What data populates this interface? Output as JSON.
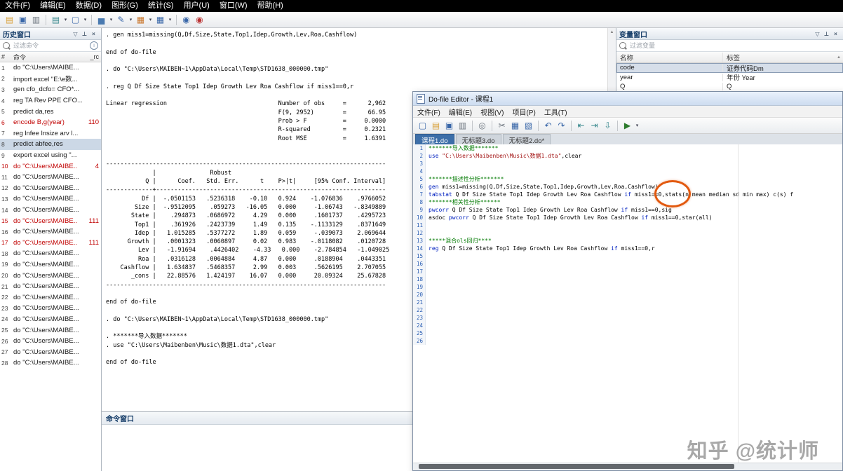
{
  "menu_bar": {
    "items": [
      "文件(F)",
      "编辑(E)",
      "数据(D)",
      "图形(G)",
      "统计(S)",
      "用户(U)",
      "窗口(W)",
      "帮助(H)"
    ]
  },
  "main_toolbar": {
    "icons": [
      {
        "name": "open-icon",
        "glyph": "▤",
        "cls": "yellow"
      },
      {
        "name": "save-icon",
        "glyph": "▣",
        "cls": "blue"
      },
      {
        "name": "print-icon",
        "glyph": "▥",
        "cls": "gray"
      },
      {
        "name": "toolbar-separator",
        "glyph": "",
        "cls": "sep"
      },
      {
        "name": "log-icon",
        "glyph": "▤",
        "cls": "teal"
      },
      {
        "name": "log-dropdown-icon",
        "glyph": "▾",
        "cls": "drop"
      },
      {
        "name": "viewer-icon",
        "glyph": "▢",
        "cls": "blue"
      },
      {
        "name": "viewer-dropdown-icon",
        "glyph": "▾",
        "cls": "drop"
      },
      {
        "name": "toolbar-separator",
        "glyph": "",
        "cls": "sep"
      },
      {
        "name": "graph-icon",
        "glyph": "▅",
        "cls": "graph"
      },
      {
        "name": "graph-dropdown-icon",
        "glyph": "▾",
        "cls": "drop"
      },
      {
        "name": "dofile-editor-icon",
        "glyph": "✎",
        "cls": "blue"
      },
      {
        "name": "dofile-editor-dropdown-icon",
        "glyph": "▾",
        "cls": "drop"
      },
      {
        "name": "data-editor-icon",
        "glyph": "▦",
        "cls": "orange"
      },
      {
        "name": "data-editor-dropdown-icon",
        "glyph": "▾",
        "cls": "drop"
      },
      {
        "name": "data-browser-icon",
        "glyph": "▦",
        "cls": "blue"
      },
      {
        "name": "data-browser-dropdown-icon",
        "glyph": "▾",
        "cls": "drop"
      },
      {
        "name": "toolbar-separator",
        "glyph": "",
        "cls": "sep"
      },
      {
        "name": "more-icon",
        "glyph": "◉",
        "cls": "blue"
      },
      {
        "name": "break-icon",
        "glyph": "◉",
        "cls": "red"
      }
    ]
  },
  "panel_icons": {
    "filter": "▽",
    "pin": "⊥",
    "close": "×",
    "scroll_up": "▲"
  },
  "history_panel": {
    "title": "历史窗口",
    "filter_placeholder": "过滤命令",
    "columns": {
      "num": "#",
      "command": "命令",
      "rc": "_rc"
    },
    "rows": [
      {
        "n": 1,
        "text": "do \"C:\\Users\\MAIBE...",
        "rc": "",
        "state": "normal"
      },
      {
        "n": 2,
        "text": "import excel \"E:\\e数...",
        "rc": "",
        "state": "normal"
      },
      {
        "n": 3,
        "text": "gen cfo_dcfo= CFO*...",
        "rc": "",
        "state": "normal"
      },
      {
        "n": 4,
        "text": "reg TA Rev PPE CFO...",
        "rc": "",
        "state": "normal"
      },
      {
        "n": 5,
        "text": "predict da,res",
        "rc": "",
        "state": "normal"
      },
      {
        "n": 6,
        "text": "encode B,g(year)",
        "rc": "110",
        "state": "error"
      },
      {
        "n": 7,
        "text": "reg lnfee lnsize arv l...",
        "rc": "",
        "state": "normal"
      },
      {
        "n": 8,
        "text": "predict abfee,res",
        "rc": "",
        "state": "selected"
      },
      {
        "n": 9,
        "text": "export excel using \"...",
        "rc": "",
        "state": "normal"
      },
      {
        "n": 10,
        "text": "do \"C:\\Users\\MAIBE..",
        "rc": "4",
        "state": "error"
      },
      {
        "n": 11,
        "text": "do \"C:\\Users\\MAIBE...",
        "rc": "",
        "state": "normal"
      },
      {
        "n": 12,
        "text": "do \"C:\\Users\\MAIBE...",
        "rc": "",
        "state": "normal"
      },
      {
        "n": 13,
        "text": "do \"C:\\Users\\MAIBE...",
        "rc": "",
        "state": "normal"
      },
      {
        "n": 14,
        "text": "do \"C:\\Users\\MAIBE...",
        "rc": "",
        "state": "normal"
      },
      {
        "n": 15,
        "text": "do \"C:\\Users\\MAIBE..",
        "rc": "111",
        "state": "error"
      },
      {
        "n": 16,
        "text": "do \"C:\\Users\\MAIBE...",
        "rc": "",
        "state": "normal"
      },
      {
        "n": 17,
        "text": "do \"C:\\Users\\MAIBE..",
        "rc": "111",
        "state": "error"
      },
      {
        "n": 18,
        "text": "do \"C:\\Users\\MAIBE...",
        "rc": "",
        "state": "normal"
      },
      {
        "n": 19,
        "text": "do \"C:\\Users\\MAIBE...",
        "rc": "",
        "state": "normal"
      },
      {
        "n": 20,
        "text": "do \"C:\\Users\\MAIBE...",
        "rc": "",
        "state": "normal"
      },
      {
        "n": 21,
        "text": "do \"C:\\Users\\MAIBE...",
        "rc": "",
        "state": "normal"
      },
      {
        "n": 22,
        "text": "do \"C:\\Users\\MAIBE...",
        "rc": "",
        "state": "normal"
      },
      {
        "n": 23,
        "text": "do \"C:\\Users\\MAIBE...",
        "rc": "",
        "state": "normal"
      },
      {
        "n": 24,
        "text": "do \"C:\\Users\\MAIBE...",
        "rc": "",
        "state": "normal"
      },
      {
        "n": 25,
        "text": "do \"C:\\Users\\MAIBE...",
        "rc": "",
        "state": "normal"
      },
      {
        "n": 26,
        "text": "do \"C:\\Users\\MAIBE...",
        "rc": "",
        "state": "normal"
      },
      {
        "n": 27,
        "text": "do \"C:\\Users\\MAIBE...",
        "rc": "",
        "state": "normal"
      },
      {
        "n": 28,
        "text": "do \"C:\\Users\\MAIBE...",
        "rc": "",
        "state": "normal"
      }
    ]
  },
  "results_window": {
    "lines": [
      ". gen miss1=missing(Q,Df,Size,State,Top1,Idep,Growth,Lev,Roa,Cashflow)",
      "",
      "end of do-file",
      "",
      ". do \"C:\\Users\\MAIBEN~1\\AppData\\Local\\Temp\\STD1638_000000.tmp\"",
      "",
      ". reg Q Df Size State Top1 Idep Growth Lev Roa Cashflow if miss1==0,r",
      "",
      "Linear regression                               Number of obs     =      2,962",
      "                                                F(9, 2952)        =      66.95",
      "                                                Prob > F          =     0.0000",
      "                                                R-squared         =     0.2321",
      "                                                Root MSE          =     1.6391",
      "",
      "",
      "------------------------------------------------------------------------------",
      "             |               Robust",
      "           Q |      Coef.   Std. Err.      t    P>|t|     [95% Conf. Interval]",
      "-------------+----------------------------------------------------------------",
      "          Df |  -.0501153   .5236318    -0.10   0.924    -1.076836    .9766052",
      "        Size |  -.9512095    .059273   -16.05   0.000     -1.06743   -.8349889",
      "       State |    .294873   .0686972     4.29   0.000     .1601737    .4295723",
      "        Top1 |    .361926   .2423739     1.49   0.135    -.1133129    .8371649",
      "        Idep |   1.015285   .5377272     1.89   0.059     -.039073    2.069644",
      "      Growth |   .0001323   .0060897     0.02   0.983    -.0118082    .0120728",
      "         Lev |   -1.91694    .4426402    -4.33   0.000    -2.784854   -1.049025",
      "         Roa |   .0316128   .0064884     4.87   0.000     .0188904    .0443351",
      "    Cashflow |   1.634837   .5468357     2.99   0.003     .5626195    2.707055",
      "       _cons |   22.88576   1.424197    16.07   0.000     20.09324    25.67828",
      "------------------------------------------------------------------------------",
      "",
      "end of do-file",
      "",
      ". do \"C:\\Users\\MAIBEN~1\\AppData\\Local\\Temp\\STD1638_000000.tmp\"",
      "",
      ". *******导入数据*******",
      ". use \"C:\\Users\\Maibenben\\Music\\数据1.dta\",clear",
      "",
      "end of do-file",
      ""
    ]
  },
  "command_window": {
    "title": "命令窗口"
  },
  "variables_panel": {
    "title": "变量窗口",
    "filter_placeholder": "过滤变量",
    "columns": {
      "name": "名称",
      "label": "标签"
    },
    "rows": [
      {
        "name": "code",
        "label": "证券代码Dm",
        "state": "selected"
      },
      {
        "name": "year",
        "label": "年份 Year",
        "state": "normal"
      },
      {
        "name": "Q",
        "label": "Q",
        "state": "normal"
      }
    ]
  },
  "dofile_editor": {
    "title": "Do-file Editor - 课程1",
    "menu_items": [
      "文件(F)",
      "编辑(E)",
      "视图(V)",
      "项目(P)",
      "工具(T)"
    ],
    "toolbar": {
      "icons": [
        {
          "name": "new-file-icon",
          "glyph": "▢",
          "cls": "blue"
        },
        {
          "name": "open-icon",
          "glyph": "▤",
          "cls": "yellow"
        },
        {
          "name": "save-icon",
          "glyph": "▣",
          "cls": "blue"
        },
        {
          "name": "print-icon",
          "glyph": "▥",
          "cls": "gray"
        },
        {
          "name": "toolbar-separator",
          "glyph": "",
          "cls": "sep"
        },
        {
          "name": "find-icon",
          "glyph": "◎",
          "cls": "gray"
        },
        {
          "name": "toolbar-separator",
          "glyph": "",
          "cls": "sep"
        },
        {
          "name": "cut-icon",
          "glyph": "✂",
          "cls": "gray"
        },
        {
          "name": "copy-icon",
          "glyph": "▦",
          "cls": "blue"
        },
        {
          "name": "paste-icon",
          "glyph": "▧",
          "cls": "blue"
        },
        {
          "name": "toolbar-separator",
          "glyph": "",
          "cls": "sep"
        },
        {
          "name": "undo-icon",
          "glyph": "↶",
          "cls": "blue"
        },
        {
          "name": "redo-icon",
          "glyph": "↷",
          "cls": "blue"
        },
        {
          "name": "toolbar-separator",
          "glyph": "",
          "cls": "sep"
        },
        {
          "name": "indent-decrease-icon",
          "glyph": "⇤",
          "cls": "teal"
        },
        {
          "name": "indent-increase-icon",
          "glyph": "⇥",
          "cls": "teal"
        },
        {
          "name": "bookmark-down-icon",
          "glyph": "⇩",
          "cls": "teal"
        },
        {
          "name": "toolbar-separator",
          "glyph": "",
          "cls": "sep"
        },
        {
          "name": "execute-do-icon",
          "glyph": "▶",
          "cls": "run"
        },
        {
          "name": "execute-dropdown-icon",
          "glyph": "▾",
          "cls": "drop"
        }
      ]
    },
    "tabs": [
      {
        "label": "课程1.do",
        "state": "active"
      },
      {
        "label": "无标题3.do",
        "state": "normal"
      },
      {
        "label": "无标题2.do*",
        "state": "normal"
      }
    ],
    "lines": [
      {
        "n": 1,
        "segs": [
          {
            "t": "*******导入数据*******",
            "c": "cmt"
          }
        ]
      },
      {
        "n": 2,
        "segs": [
          {
            "t": "use ",
            "c": "kw"
          },
          {
            "t": "\"C:\\Users\\Maibenben\\Music\\数据1.dta\"",
            "c": "str"
          },
          {
            "t": ",clear",
            "c": "txt"
          }
        ]
      },
      {
        "n": 3,
        "segs": []
      },
      {
        "n": 4,
        "segs": []
      },
      {
        "n": 5,
        "segs": [
          {
            "t": "*******描述性分析*******",
            "c": "cmt"
          }
        ]
      },
      {
        "n": 6,
        "segs": [
          {
            "t": "gen ",
            "c": "kw"
          },
          {
            "t": "miss1=missing(Q,Df,Size,State,Top1,Idep,Growth,Lev,Roa,Cashflow)",
            "c": "txt"
          }
        ]
      },
      {
        "n": 7,
        "segs": [
          {
            "t": "tabstat ",
            "c": "kw"
          },
          {
            "t": "Q Df Size State Top1 Idep Growth Lev Roa Cashflow ",
            "c": "txt"
          },
          {
            "t": "if",
            "c": "kw"
          },
          {
            "t": " miss1==0,stats(n mean median sd min max) c(s) f",
            "c": "txt"
          }
        ]
      },
      {
        "n": 8,
        "segs": [
          {
            "t": "*******相关性分析******",
            "c": "cmt"
          }
        ]
      },
      {
        "n": 9,
        "segs": [
          {
            "t": "pwcorr ",
            "c": "kw"
          },
          {
            "t": "Q Df Size State Top1 Idep Growth Lev Roa Cashflow ",
            "c": "txt"
          },
          {
            "t": "if",
            "c": "kw"
          },
          {
            "t": " miss1==0,sig",
            "c": "txt"
          }
        ]
      },
      {
        "n": 10,
        "segs": [
          {
            "t": "asdoc ",
            "c": "txt"
          },
          {
            "t": "pwcorr ",
            "c": "kw"
          },
          {
            "t": "Q Df Size State Top1 Idep Growth Lev Roa Cashflow ",
            "c": "txt"
          },
          {
            "t": "if",
            "c": "kw"
          },
          {
            "t": " miss1==0,star(all)",
            "c": "txt"
          }
        ]
      },
      {
        "n": 11,
        "segs": []
      },
      {
        "n": 12,
        "segs": []
      },
      {
        "n": 13,
        "segs": [
          {
            "t": "*****混合ols回归****",
            "c": "cmt"
          }
        ]
      },
      {
        "n": 14,
        "segs": [
          {
            "t": "reg ",
            "c": "kw"
          },
          {
            "t": "Q Df Size State Top1 Idep Growth Lev Roa Cashflow ",
            "c": "txt"
          },
          {
            "t": "if",
            "c": "kw"
          },
          {
            "t": " miss1==0,r",
            "c": "txt"
          }
        ]
      },
      {
        "n": 15,
        "segs": []
      },
      {
        "n": 16,
        "segs": []
      },
      {
        "n": 17,
        "segs": []
      },
      {
        "n": 18,
        "segs": []
      },
      {
        "n": 19,
        "segs": []
      },
      {
        "n": 20,
        "segs": []
      },
      {
        "n": 21,
        "segs": []
      },
      {
        "n": 22,
        "segs": []
      },
      {
        "n": 23,
        "segs": []
      },
      {
        "n": 24,
        "segs": []
      },
      {
        "n": 25,
        "segs": []
      },
      {
        "n": 26,
        "segs": []
      }
    ]
  },
  "watermark": {
    "text": "知乎 @统计师"
  },
  "colors": {
    "accent_blue": "#3c6ea8",
    "error_red": "#c00000",
    "comment_green": "#007a00",
    "keyword_blue": "#0020c0",
    "string_red": "#a31515",
    "annotation_orange": "#e2590f",
    "selection_bg": "#ccd8e6"
  }
}
